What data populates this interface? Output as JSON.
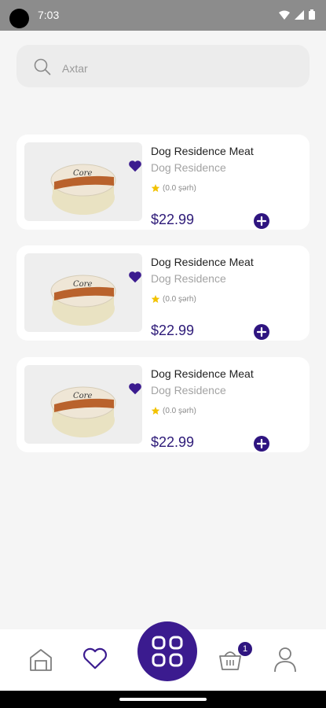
{
  "status_bar": {
    "time": "7:03"
  },
  "search": {
    "placeholder": "Axtar"
  },
  "products": [
    {
      "name": "Dog Residence Meat",
      "brand": "Dog Residence",
      "rating_text": "(0.0 şərh)",
      "price": "$22.99"
    },
    {
      "name": "Dog Residence Meat",
      "brand": "Dog Residence",
      "rating_text": "(0.0 şərh)",
      "price": "$22.99"
    },
    {
      "name": "Dog Residence Meat",
      "brand": "Dog Residence",
      "rating_text": "(0.0 şərh)",
      "price": "$22.99"
    }
  ],
  "bottom_nav": {
    "cart_badge": "1"
  },
  "colors": {
    "accent": "#2f1580",
    "price": "#2d1a78",
    "star": "#f2c200"
  },
  "icons": [
    "search-icon",
    "heart-icon",
    "star-icon",
    "plus-icon",
    "home-icon",
    "favorites-icon",
    "categories-grid-icon",
    "cart-icon",
    "profile-icon"
  ]
}
